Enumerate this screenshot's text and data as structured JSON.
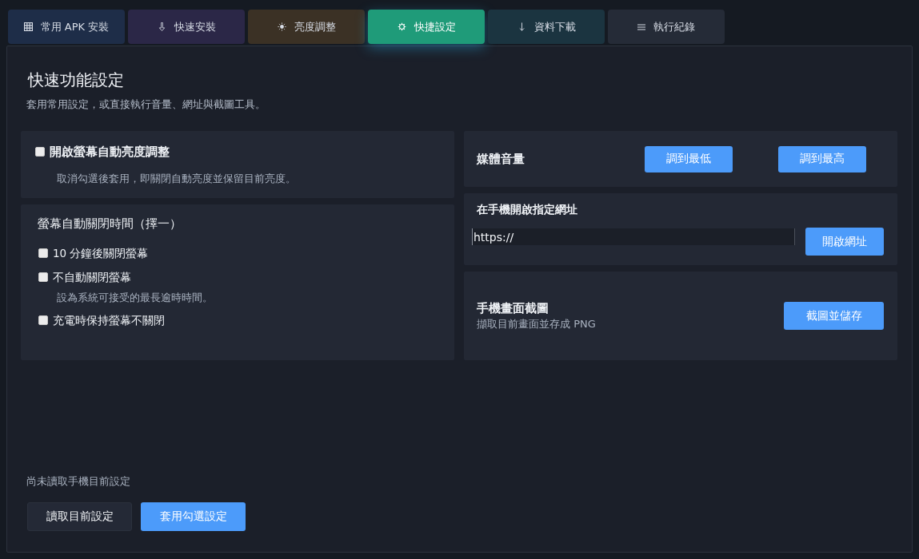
{
  "tabs": [
    {
      "label": "常用 APK 安裝",
      "selected": false,
      "color": "#1e2d48"
    },
    {
      "label": "快速安裝",
      "selected": false,
      "color": "#2b2747"
    },
    {
      "label": "亮度調整",
      "selected": false,
      "color": "#3b3125"
    },
    {
      "label": "快捷設定",
      "selected": true,
      "color": "#1f9b79"
    },
    {
      "label": "資料下載",
      "selected": false,
      "color": "#1b3440"
    },
    {
      "label": "執行紀錄",
      "selected": false,
      "color": "#252b37"
    }
  ],
  "panel": {
    "title": "快速功能設定",
    "subtitle": "套用常用設定，或直接執行音量、網址與截圖工具。",
    "auto_brightness": {
      "label": "開啟螢幕自動亮度調整",
      "checked": false,
      "hint": "取消勾選後套用，即關閉自動亮度並保留目前亮度。"
    },
    "screen_timeout": {
      "title": "螢幕自動關閉時間（擇一）",
      "options": [
        {
          "label": "10 分鐘後關閉螢幕",
          "checked": false
        },
        {
          "label": "不自動關閉螢幕",
          "checked": false,
          "hint": "設為系統可接受的最長逾時時間。"
        },
        {
          "label": "充電時保持螢幕不關閉",
          "checked": false
        }
      ]
    },
    "media_volume": {
      "label": "媒體音量",
      "buttons": [
        "調到最低",
        "調到最高"
      ]
    },
    "open_url": {
      "title": "在手機開啟指定網址",
      "value": "https://",
      "button": "開啟網址"
    },
    "screenshot": {
      "title": "手機畫面截圖",
      "description": "擷取目前畫面並存成 PNG",
      "button": "截圖並儲存"
    },
    "status": "尚未讀取手機目前設定",
    "actions": [
      {
        "label": "讀取目前設定",
        "kind": "secondary"
      },
      {
        "label": "套用勾選設定",
        "kind": "primary"
      }
    ]
  }
}
